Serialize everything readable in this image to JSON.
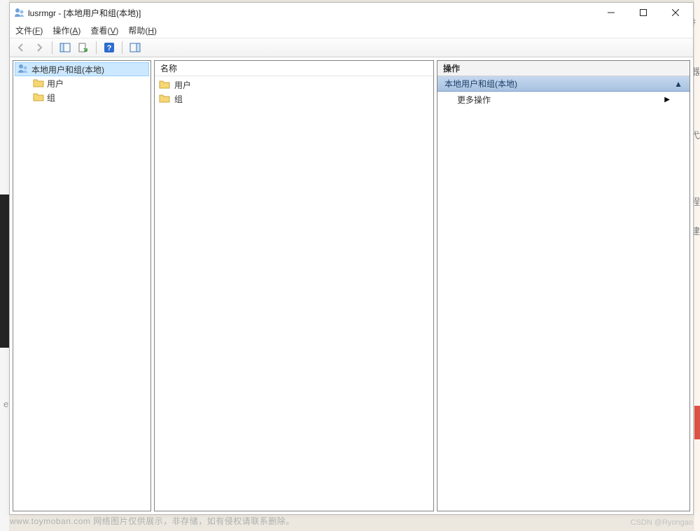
{
  "titlebar": {
    "app": "lusrmgr",
    "doc": "[本地用户和组(本地)]"
  },
  "menubar": {
    "file": "文件(",
    "file_u": "F",
    "file_end": ")",
    "action": "操作(",
    "action_u": "A",
    "action_end": ")",
    "view": "查看(",
    "view_u": "V",
    "view_end": ")",
    "help": "帮助(",
    "help_u": "H",
    "help_end": ")"
  },
  "tree": {
    "root": "本地用户和组(本地)",
    "users": "用户",
    "groups": "组"
  },
  "list": {
    "header_name": "名称",
    "users": "用户",
    "groups": "组"
  },
  "actions": {
    "title": "操作",
    "group_title": "本地用户和组(本地)",
    "more": "更多操作"
  },
  "watermark": "www.toymoban.com 网络图片仅供展示，非存储，如有侵权请联系删除。",
  "csdn": "CSDN @Ryongao",
  "bg_chars": {
    "a": "扌",
    "b": "器",
    "c": "程",
    "d": "建",
    "e": "e",
    "f": "弋"
  }
}
